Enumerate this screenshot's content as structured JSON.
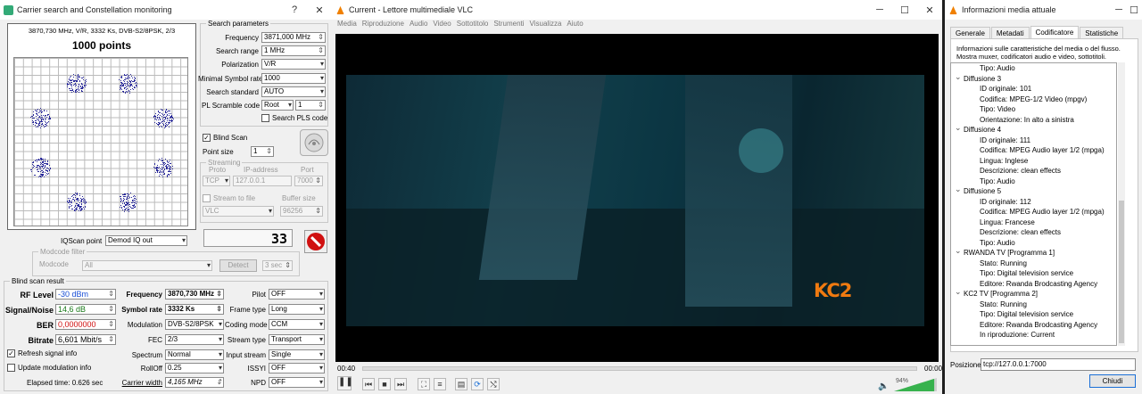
{
  "carrier": {
    "title": "Carrier search and Constellation monitoring",
    "help": "?",
    "close": "✕",
    "plot_header": "3870,730 MHz, V/R, 3332 Ks, DVB-S2/8PSK, 2/3",
    "plot_points": "1000 points",
    "search_group": "Search parameters",
    "frequency_label": "Frequency",
    "frequency_value": "3871,000 MHz",
    "search_range_label": "Search range",
    "search_range_value": "1 MHz",
    "polarization_label": "Polarization",
    "polarization_value": "V/R",
    "min_sr_label": "Minimal Symbol rate",
    "min_sr_value": "1000",
    "search_std_label": "Search standard",
    "search_std_value": "AUTO",
    "pls_label": "PL Scramble code",
    "pls_mode": "Root",
    "pls_value": "1",
    "search_pls_label": "Search PLS code",
    "blind_scan_label": "Blind Scan",
    "blind_scan_checked": "✓",
    "point_size_label": "Point size",
    "point_size_value": "1",
    "streaming_group": "Streaming",
    "proto_label": "Proto",
    "ip_label": "IP-address",
    "port_label": "Port",
    "proto_value": "TCP",
    "ip_value": "127.0.0.1",
    "port_value": "7000",
    "stream_to_file_label": "Stream to file",
    "buffer_label": "Buffer size",
    "stream_target": "VLC",
    "buffer_value": "96256",
    "counter": "33",
    "iqscan_label": "IQScan point",
    "iqscan_value": "Demod IQ out",
    "modcode_group": "Modcode filter",
    "modcode_label": "Modcode",
    "modcode_value": "All",
    "detect_label": "Detect",
    "detect_time": "3 sec",
    "result_group": "Blind scan result",
    "rf_label": "RF Level",
    "rf_value": "-30 dBm",
    "sn_label": "Signal/Noise",
    "sn_value": "14,6 dB",
    "ber_label": "BER",
    "ber_value": "0,0000000",
    "bitrate_label": "Bitrate",
    "bitrate_value": "6,601 Mbit/s",
    "freq2_label": "Frequency",
    "freq2_value": "3870,730 MHz",
    "sr_label": "Symbol rate",
    "sr_value": "3332 Ks",
    "mod_label": "Modulation",
    "mod_value": "DVB-S2/8PSK",
    "fec_label": "FEC",
    "fec_value": "2/3",
    "spectrum_label": "Spectrum",
    "spectrum_value": "Normal",
    "rolloff_label": "RollOff",
    "rolloff_value": "0.25",
    "cw_label": "Carrier width",
    "cw_value": "4,165 MHz",
    "pilot_label": "Pilot",
    "pilot_value": "OFF",
    "frame_label": "Frame type",
    "frame_value": "Long",
    "coding_label": "Coding mode",
    "coding_value": "CCM",
    "stream_type_label": "Stream type",
    "stream_type_value": "Transport",
    "input_stream_label": "Input stream",
    "input_stream_value": "Single",
    "issyi_label": "ISSYI",
    "issyi_value": "OFF",
    "npd_label": "NPD",
    "npd_value": "OFF",
    "refresh_label": "Refresh signal info",
    "refresh_checked": "✓",
    "update_mod_label": "Update modulation info",
    "elapsed": "Elapsed time: 0.626 sec",
    "colors": {
      "rf": "#1a4fd6",
      "sn": "#1a7a1a",
      "ber": "#d01010",
      "stop": "#d01010"
    }
  },
  "vlc": {
    "title": "Current - Lettore multimediale VLC",
    "menu": [
      "Media",
      "Riproduzione",
      "Audio",
      "Video",
      "Sottotitolo",
      "Strumenti",
      "Visualizza",
      "Aiuto"
    ],
    "logo_text": "KC2",
    "time_elapsed": "00:40",
    "time_total": "00:00",
    "volume": "94%",
    "progress": 0
  },
  "info": {
    "title": "Informazioni media attuale",
    "tabs": [
      "Generale",
      "Metadati",
      "Codificatore",
      "Statistiche"
    ],
    "description": [
      "Informazioni sulle caratteristiche del media o del flusso.",
      "Mostra muxer, codificatori audio e video, sottotitoli."
    ],
    "tree": [
      {
        "t": "Tipo: Audio",
        "lvl": 2
      },
      {
        "t": "Diffusione 3",
        "lvl": 1
      },
      {
        "t": "ID originale: 101",
        "lvl": 2
      },
      {
        "t": "Codifica: MPEG-1/2 Video (mpgv)",
        "lvl": 2
      },
      {
        "t": "Tipo: Video",
        "lvl": 2
      },
      {
        "t": "Orientazione: In alto a sinistra",
        "lvl": 2
      },
      {
        "t": "Diffusione 4",
        "lvl": 1
      },
      {
        "t": "ID originale: 111",
        "lvl": 2
      },
      {
        "t": "Codifica: MPEG Audio layer 1/2 (mpga)",
        "lvl": 2
      },
      {
        "t": "Lingua: Inglese",
        "lvl": 2
      },
      {
        "t": "Descrizione: clean effects",
        "lvl": 2
      },
      {
        "t": "Tipo: Audio",
        "lvl": 2
      },
      {
        "t": "Diffusione 5",
        "lvl": 1
      },
      {
        "t": "ID originale: 112",
        "lvl": 2
      },
      {
        "t": "Codifica: MPEG Audio layer 1/2 (mpga)",
        "lvl": 2
      },
      {
        "t": "Lingua: Francese",
        "lvl": 2
      },
      {
        "t": "Descrizione: clean effects",
        "lvl": 2
      },
      {
        "t": "Tipo: Audio",
        "lvl": 2
      },
      {
        "t": "RWANDA TV [Programma 1]",
        "lvl": 1
      },
      {
        "t": "Stato: Running",
        "lvl": 2
      },
      {
        "t": "Tipo: Digital television service",
        "lvl": 2
      },
      {
        "t": "Editore: Rwanda Brodcasting Agency",
        "lvl": 2
      },
      {
        "t": "KC2 TV [Programma 2]",
        "lvl": 1
      },
      {
        "t": "Stato: Running",
        "lvl": 2
      },
      {
        "t": "Tipo: Digital television service",
        "lvl": 2
      },
      {
        "t": "Editore: Rwanda Brodcasting Agency",
        "lvl": 2
      },
      {
        "t": "In riproduzione: Current",
        "lvl": 2
      }
    ],
    "position_label": "Posizione:",
    "position_value": "tcp://127.0.0.1:7000",
    "close_label": "Chiudi"
  }
}
